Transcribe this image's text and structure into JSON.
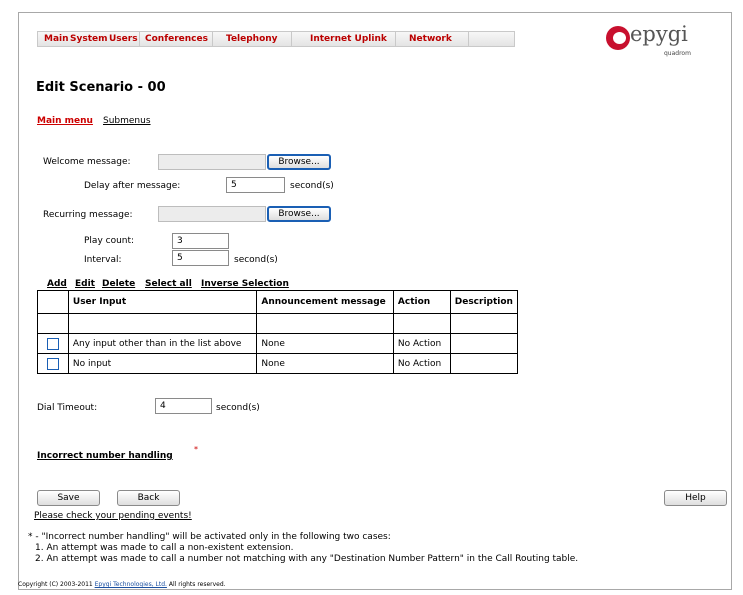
{
  "nav": {
    "items": [
      "Main",
      "System",
      "Users",
      "Conferences",
      "Telephony",
      "Internet Uplink",
      "Network"
    ]
  },
  "logo": {
    "text": "epygi",
    "subtitle": "quadrom"
  },
  "page_title": "Edit Scenario - 00",
  "tabs": {
    "main": "Main menu",
    "sub": "Submenus"
  },
  "welcome": {
    "label": "Welcome message:",
    "browse": "Browse..."
  },
  "delay": {
    "label": "Delay after message:",
    "value": "5",
    "unit": "second(s)"
  },
  "recurring": {
    "label": "Recurring message:",
    "browse": "Browse..."
  },
  "play_count": {
    "label": "Play count:",
    "value": "3"
  },
  "interval": {
    "label": "Interval:",
    "value": "5",
    "unit": "second(s)"
  },
  "table_links": {
    "add": "Add",
    "edit": "Edit",
    "delete": "Delete",
    "select_all": "Select all",
    "inverse": "Inverse Selection"
  },
  "table": {
    "headers": [
      "User Input",
      "Announcement message",
      "Action",
      "Description"
    ],
    "rows": [
      {
        "input": "Any input other than in the list above",
        "announcement": "None",
        "action": "No Action",
        "description": ""
      },
      {
        "input": "No input",
        "announcement": "None",
        "action": "No Action",
        "description": ""
      }
    ]
  },
  "dial_timeout": {
    "label": "Dial Timeout:",
    "value": "4",
    "unit": "second(s)"
  },
  "incorrect_number": {
    "label": "Incorrect number handling",
    "mark": "*"
  },
  "buttons": {
    "save": "Save",
    "back": "Back",
    "help": "Help"
  },
  "pending_events": "Please check your pending events!",
  "footnote": {
    "line1": "* - \"Incorrect number handling\" will be activated only in the following two cases:",
    "line2": "1. An attempt was made to call a non-existent extension.",
    "line3": "2. An attempt was made to call a number not matching with any \"Destination Number Pattern\" in the Call Routing table."
  },
  "copyright": {
    "prefix": "Copyright (C) 2003-2011 ",
    "company": "Epygi Technologies, Ltd.",
    "suffix": " All rights reserved."
  }
}
